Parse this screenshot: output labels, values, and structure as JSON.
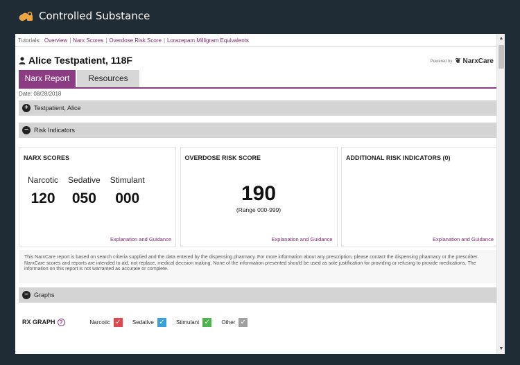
{
  "app": {
    "title": "Controlled Substance"
  },
  "tutorials": {
    "label": "Tutorials:",
    "links": [
      "Overview",
      "Narx Scores",
      "Overdose Risk Score",
      "Lorazepam Milligram Equivalents"
    ]
  },
  "patient": {
    "name": "Alice Testpatient, 118F"
  },
  "powered_by": {
    "prefix": "Powered by",
    "brand": "NarxCare"
  },
  "tabs": [
    {
      "label": "Narx Report",
      "active": true
    },
    {
      "label": "Resources",
      "active": false
    }
  ],
  "date": "Date: 08/28/2018",
  "sections": {
    "patient_section": "Testpatient, Alice",
    "risk_section": "Risk Indicators",
    "graphs_section": "Graphs"
  },
  "narx_scores": {
    "title": "NARX SCORES",
    "labels": [
      "Narcotic",
      "Sedative",
      "Stimulant"
    ],
    "values": [
      "120",
      "050",
      "000"
    ],
    "link": "Explanation and Guidance"
  },
  "overdose": {
    "title": "OVERDOSE RISK SCORE",
    "value": "190",
    "range": "(Range 000-999)",
    "link": "Explanation and Guidance"
  },
  "additional": {
    "title": "ADDITIONAL RISK INDICATORS (0)",
    "link": "Explanation and Guidance"
  },
  "disclaimer": "This NarxCare report is based on search criteria supplied and the data entered by the dispensing pharmacy. For more information about any prescription, please contact the dispensing pharmacy or the prescriber. NarxCare scores and reports are intended to aid, not replace, medical decision making. None of the information presented should be used as sole justification for providing or refusing to provide medications. The information on this report is not warranted as accurate or complete.",
  "rx_graph": {
    "title": "RX GRAPH",
    "legend": [
      {
        "label": "Narcotic",
        "color": "#e0474c"
      },
      {
        "label": "Sedative",
        "color": "#3aa0d8"
      },
      {
        "label": "Stimulant",
        "color": "#4db34d"
      },
      {
        "label": "Other",
        "color": "#a0a0a0"
      }
    ]
  },
  "colors": {
    "accent": "#8c3c82",
    "titlebar": "#1f2b35"
  }
}
